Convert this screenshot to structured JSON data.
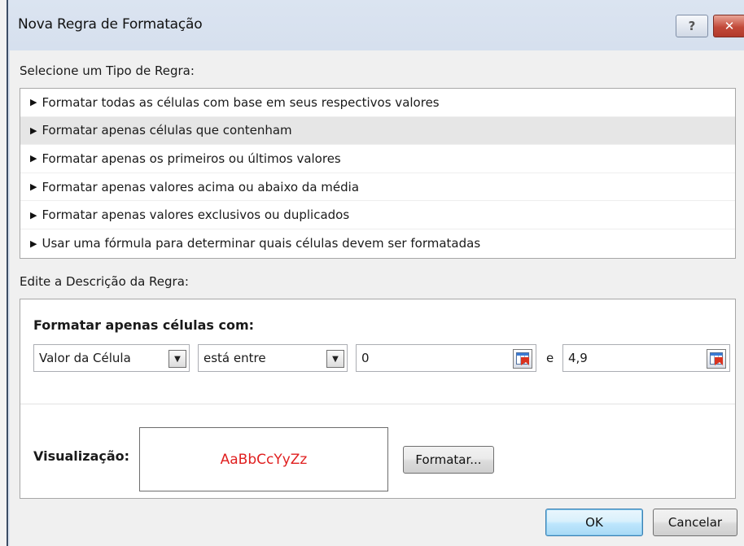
{
  "window": {
    "title": "Nova Regra de Formatação",
    "help_glyph": "?",
    "close_glyph": "✕"
  },
  "rule_type": {
    "label": "Selecione um Tipo de Regra:",
    "selected_index": 1,
    "items": [
      {
        "label": "Formatar todas as células com base em seus respectivos valores"
      },
      {
        "label": "Formatar apenas células que contenham"
      },
      {
        "label": "Formatar apenas os primeiros ou últimos valores"
      },
      {
        "label": "Formatar apenas valores acima ou abaixo da média"
      },
      {
        "label": "Formatar apenas valores exclusivos ou duplicados"
      },
      {
        "label": "Usar uma fórmula para determinar quais células devem ser formatadas"
      }
    ]
  },
  "description": {
    "label": "Edite a Descrição da Regra:",
    "heading": "Formatar apenas células com:",
    "condition_type": "Valor da Célula",
    "operator": "está entre",
    "value1": "0",
    "conjunction": "e",
    "value2": "4,9",
    "preview_label": "Visualização:",
    "preview_text": "AaBbCcYyZz",
    "preview_color": "#e02020",
    "format_button": "Formatar..."
  },
  "buttons": {
    "ok": "OK",
    "cancel": "Cancelar"
  },
  "icons": {
    "dropdown": "chevron-down-icon",
    "range_select": "range-select-icon",
    "rule_bullet": "triangle-right-icon"
  }
}
